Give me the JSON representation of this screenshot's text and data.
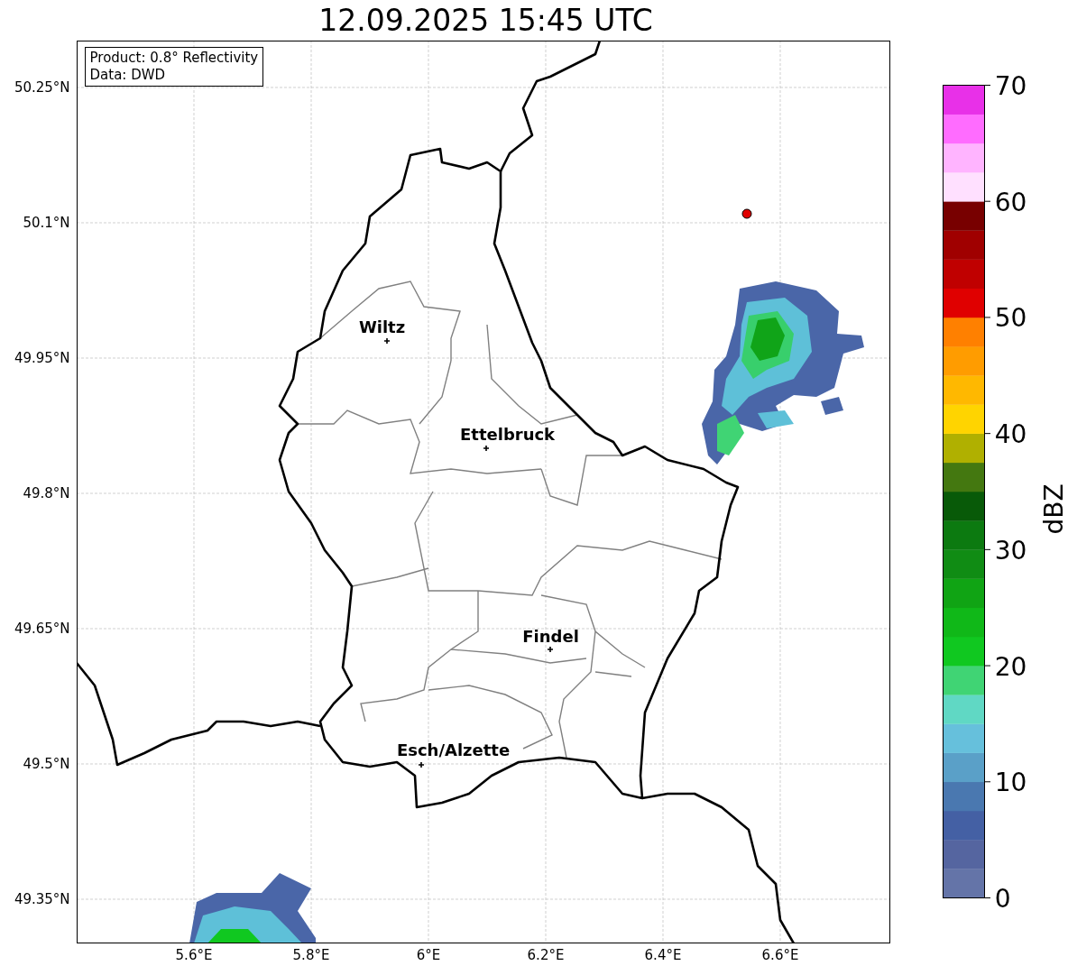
{
  "title": "12.09.2025 15:45 UTC",
  "legend": {
    "lines": [
      "Product: 0.8° Reflectivity",
      "Data: DWD"
    ]
  },
  "map": {
    "lat_ticks": [
      "50.25°N",
      "50.1°N",
      "49.95°N",
      "49.8°N",
      "49.65°N",
      "49.5°N",
      "49.35°N"
    ],
    "lon_ticks": [
      "5.6°E",
      "5.8°E",
      "6°E",
      "6.2°E",
      "6.4°E",
      "6.6°E"
    ],
    "cities": [
      {
        "name": "Wiltz"
      },
      {
        "name": "Ettelbruck"
      },
      {
        "name": "Findel"
      },
      {
        "name": "Esch/Alzette"
      }
    ]
  },
  "colorbar": {
    "label": "dBZ",
    "ticks": [
      "70",
      "60",
      "50",
      "40",
      "30",
      "20",
      "10",
      "0"
    ]
  }
}
